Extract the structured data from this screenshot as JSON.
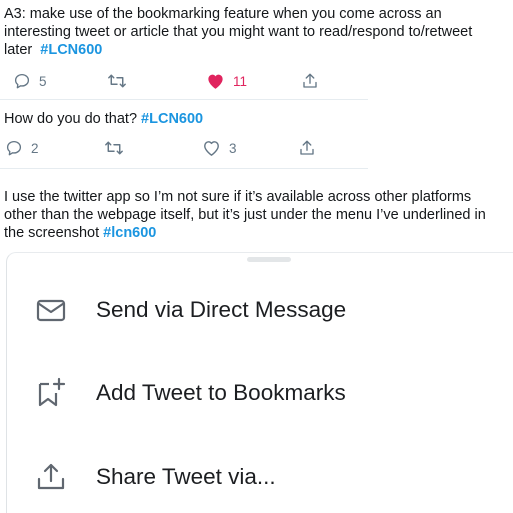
{
  "tweet1": {
    "lines": [
      "A3: make use of the bookmarking feature when you come across an",
      "interesting tweet or article that you might want to read/respond to/retweet"
    ],
    "last_line_text": "later",
    "hashtag": "#LCN600",
    "replies": "5",
    "likes": "11",
    "liked": true
  },
  "tweet2": {
    "text": "How do you do that?",
    "hashtag": "#LCN600",
    "replies": "2",
    "likes": "3"
  },
  "tweet3": {
    "lines": [
      "I use the twitter app so I’m not sure if it’s available across other platforms",
      "other than the webpage itself, but it’s just under the menu I’ve underlined in"
    ],
    "last_line_text": "the screenshot",
    "hashtag": "#lcn600"
  },
  "share_sheet": {
    "items": [
      {
        "label": "Send via Direct Message",
        "icon": "envelope-icon"
      },
      {
        "label": "Add Tweet to Bookmarks",
        "icon": "bookmark-add-icon"
      },
      {
        "label": "Share Tweet via...",
        "icon": "share-icon"
      }
    ]
  },
  "colors": {
    "text": "#14171a",
    "muted": "#657786",
    "link": "#1b95e0",
    "like": "#e0245e"
  }
}
